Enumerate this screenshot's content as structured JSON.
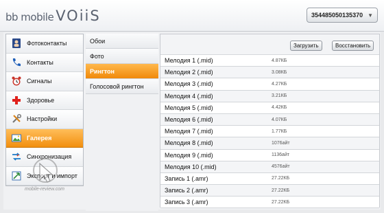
{
  "app": {
    "logo_bb": "bb mobile",
    "logo_product": "VOiiS"
  },
  "header": {
    "device_id": "354485050135370"
  },
  "nav": {
    "items": [
      {
        "label": "Фотоконтакты",
        "icon": "contacts-book-icon",
        "active": false
      },
      {
        "label": "Контакты",
        "icon": "phone-handset-icon",
        "active": false
      },
      {
        "label": "Сигналы",
        "icon": "alarm-clock-icon",
        "active": false
      },
      {
        "label": "Здоровье",
        "icon": "health-cross-icon",
        "active": false
      },
      {
        "label": "Настройки",
        "icon": "tools-icon",
        "active": false
      },
      {
        "label": "Галерея",
        "icon": "gallery-icon",
        "active": true
      },
      {
        "label": "Синхронизация",
        "icon": "sync-arrows-icon",
        "active": false
      },
      {
        "label": "Экспорт и импорт",
        "icon": "export-import-icon",
        "active": false
      }
    ]
  },
  "submenu": {
    "items": [
      {
        "label": "Обои",
        "active": false
      },
      {
        "label": "Фото",
        "active": false
      },
      {
        "label": "Рингтон",
        "active": true
      },
      {
        "label": "Голосовой рингтон",
        "active": false
      }
    ]
  },
  "toolbar": {
    "upload_label": "Загрузить",
    "restore_label": "Восстановить"
  },
  "files": [
    {
      "name": "Мелодия 1 (.mid)",
      "size": "4.87КБ"
    },
    {
      "name": "Мелодия 2 (.mid)",
      "size": "3.08КБ"
    },
    {
      "name": "Мелодия 3 (.mid)",
      "size": "4.27КБ"
    },
    {
      "name": "Мелодия 4 (.mid)",
      "size": "3.21КБ"
    },
    {
      "name": "Мелодия 5 (.mid)",
      "size": "4.42КБ"
    },
    {
      "name": "Мелодия 6 (.mid)",
      "size": "4.07КБ"
    },
    {
      "name": "Мелодия 7 (.mid)",
      "size": "1.77КБ"
    },
    {
      "name": "Мелодия 8 (.mid)",
      "size": "1076айт"
    },
    {
      "name": "Мелодия 9 (.mid)",
      "size": "1136айт"
    },
    {
      "name": "Мелодия 10 (.mid)",
      "size": "4576айт"
    },
    {
      "name": "Запись 1 (.amr)",
      "size": "27.22КБ"
    },
    {
      "name": "Запись 2 (.amr)",
      "size": "27.22КБ"
    },
    {
      "name": "Запись 3 (.amr)",
      "size": "27.22КБ"
    }
  ],
  "watermark": {
    "text": "mobile-review.com"
  },
  "colors": {
    "accent": "#f29418",
    "panel": "#f0f1f3"
  }
}
